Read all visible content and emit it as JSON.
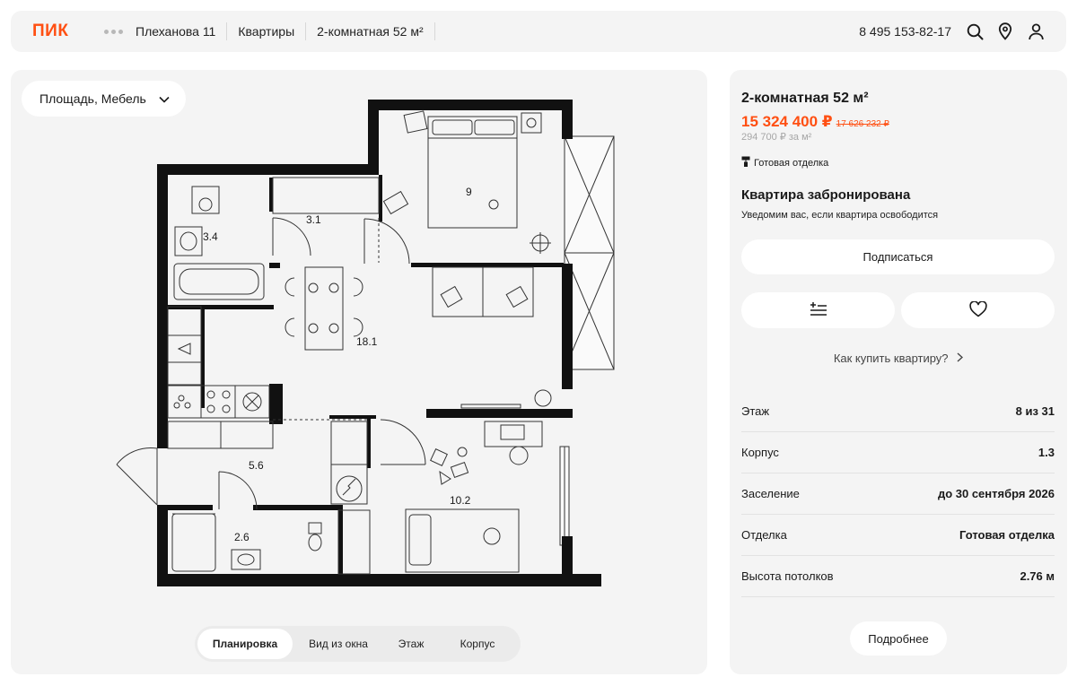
{
  "header": {
    "logo": "ПИК",
    "breadcrumbs": [
      "Плеханова 11",
      "Квартиры",
      "2-комнатная 52 м²"
    ],
    "phone": "8 495 153-82-17"
  },
  "plan": {
    "layer_select": "Площадь, Мебель",
    "rooms": [
      {
        "name": "bathroom",
        "area": "3.4"
      },
      {
        "name": "corridor",
        "area": "3.1"
      },
      {
        "name": "bedroom",
        "area": "9"
      },
      {
        "name": "kitchen-living",
        "area": "18.1"
      },
      {
        "name": "hallway",
        "area": "5.6"
      },
      {
        "name": "wc",
        "area": "2.6"
      },
      {
        "name": "room",
        "area": "10.2"
      }
    ],
    "view_tabs": [
      {
        "label": "Планировка",
        "active": true
      },
      {
        "label": "Вид из окна",
        "active": false
      },
      {
        "label": "Этаж",
        "active": false
      },
      {
        "label": "Корпус",
        "active": false
      }
    ]
  },
  "info": {
    "title": "2-комнатная 52 м²",
    "price": "15 324 400 ₽",
    "old_price": "17 626 232 ₽",
    "price_per_m": "294 700 ₽ за м²",
    "finish_tag": "Готовая отделка",
    "reserved_title": "Квартира забронирована",
    "reserved_sub": "Уведомим вас, если квартира освободится",
    "subscribe_label": "Подписаться",
    "how_buy": "Как купить квартиру?",
    "specs": [
      {
        "label": "Этаж",
        "value": "8 из 31"
      },
      {
        "label": "Корпус",
        "value": "1.3"
      },
      {
        "label": "Заселение",
        "value": "до 30 сентября 2026"
      },
      {
        "label": "Отделка",
        "value": "Готовая отделка"
      },
      {
        "label": "Высота потолков",
        "value": "2.76 м"
      }
    ],
    "more_label": "Подробнее"
  },
  "colors": {
    "accent": "#ff4f12",
    "panel": "#f4f4f4",
    "wall": "#111111"
  }
}
